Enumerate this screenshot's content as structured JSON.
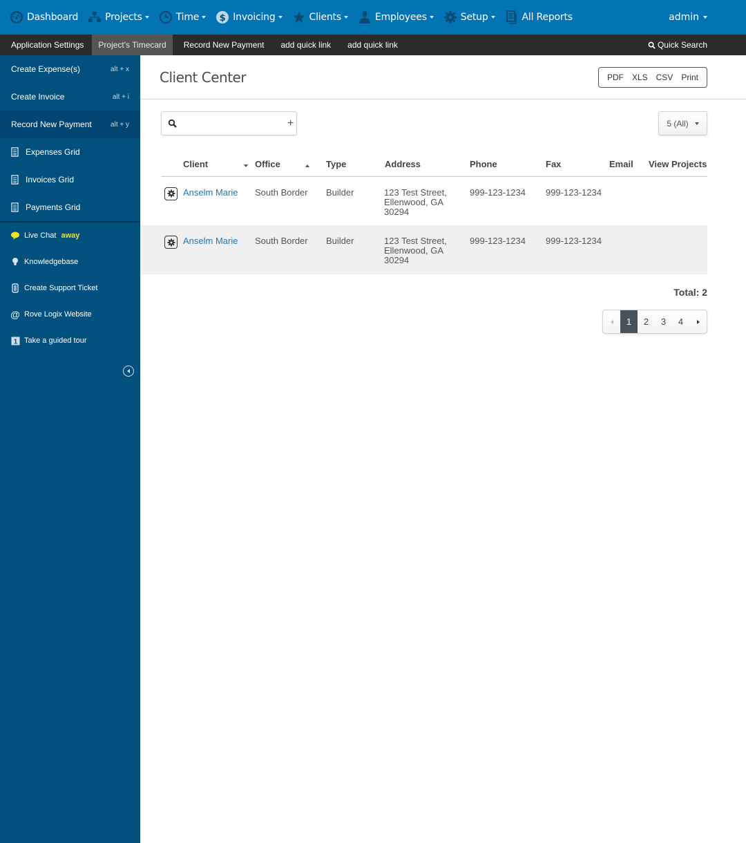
{
  "topnav": {
    "items": [
      {
        "label": "Dashboard",
        "icon": "dashboard-icon",
        "dropdown": false
      },
      {
        "label": "Projects",
        "icon": "sitemap-icon",
        "dropdown": true
      },
      {
        "label": "Time",
        "icon": "clock-icon",
        "dropdown": true
      },
      {
        "label": "Invoicing",
        "icon": "dollar-icon",
        "dropdown": true
      },
      {
        "label": "Clients",
        "icon": "star-icon",
        "dropdown": true
      },
      {
        "label": "Employees",
        "icon": "user-icon",
        "dropdown": true
      },
      {
        "label": "Setup",
        "icon": "gear-icon",
        "dropdown": true
      },
      {
        "label": "All Reports",
        "icon": "document-icon",
        "dropdown": false
      }
    ],
    "user": "admin"
  },
  "quickbar": {
    "links": [
      "Application Settings",
      "Project's Timecard",
      "Record New Payment",
      "add quick link",
      "add quick link"
    ],
    "active_index": 1,
    "search_label": "Quick Search"
  },
  "sidebar": {
    "actions": [
      {
        "label": "Create Expense(s)",
        "shortcut": "alt + x"
      },
      {
        "label": "Create Invoice",
        "shortcut": "alt + i"
      },
      {
        "label": "Record New Payment",
        "shortcut": "alt + y"
      }
    ],
    "grids": [
      "Expenses Grid",
      "Invoices Grid",
      "Payments Grid"
    ],
    "help": [
      {
        "label": "Live Chat",
        "status": "away",
        "icon": "chat-bubble-icon"
      },
      {
        "label": "Knowledgebase",
        "icon": "lightbulb-icon"
      },
      {
        "label": "Create Support Ticket",
        "icon": "ticket-icon"
      },
      {
        "label": "Rove Logix Website",
        "icon": "at-sign-icon"
      },
      {
        "label": "Take a guided tour",
        "icon": "tour-icon"
      }
    ],
    "colors": {
      "background": "#02507e",
      "status_away": "#f3e21c"
    }
  },
  "main": {
    "title": "Client Center",
    "export": [
      "PDF",
      "XLS",
      "CSV",
      "Print"
    ],
    "search": {
      "value": "",
      "placeholder": ""
    },
    "page_size": "5 (All)",
    "columns": [
      "Client",
      "Office",
      "Type",
      "Address",
      "Phone",
      "Fax",
      "Email",
      "View Projects"
    ],
    "rows": [
      {
        "client": "Anselm Marie",
        "office": "South Border",
        "type": "Builder",
        "address": [
          "123 Test Street,",
          "Ellenwood, GA",
          "30294"
        ],
        "phone": "999-123-1234",
        "fax": "999-123-1234",
        "email": "",
        "view_projects": ""
      },
      {
        "client": "Anselm Marie",
        "office": "South Border",
        "type": "Builder",
        "address": [
          "123 Test Street,",
          "Ellenwood, GA",
          "30294"
        ],
        "phone": "999-123-1234",
        "fax": "999-123-1234",
        "email": "",
        "view_projects": ""
      }
    ],
    "total": "Total: 2",
    "pagination": {
      "pages": [
        "1",
        "2",
        "3",
        "4"
      ],
      "current": "1"
    }
  }
}
